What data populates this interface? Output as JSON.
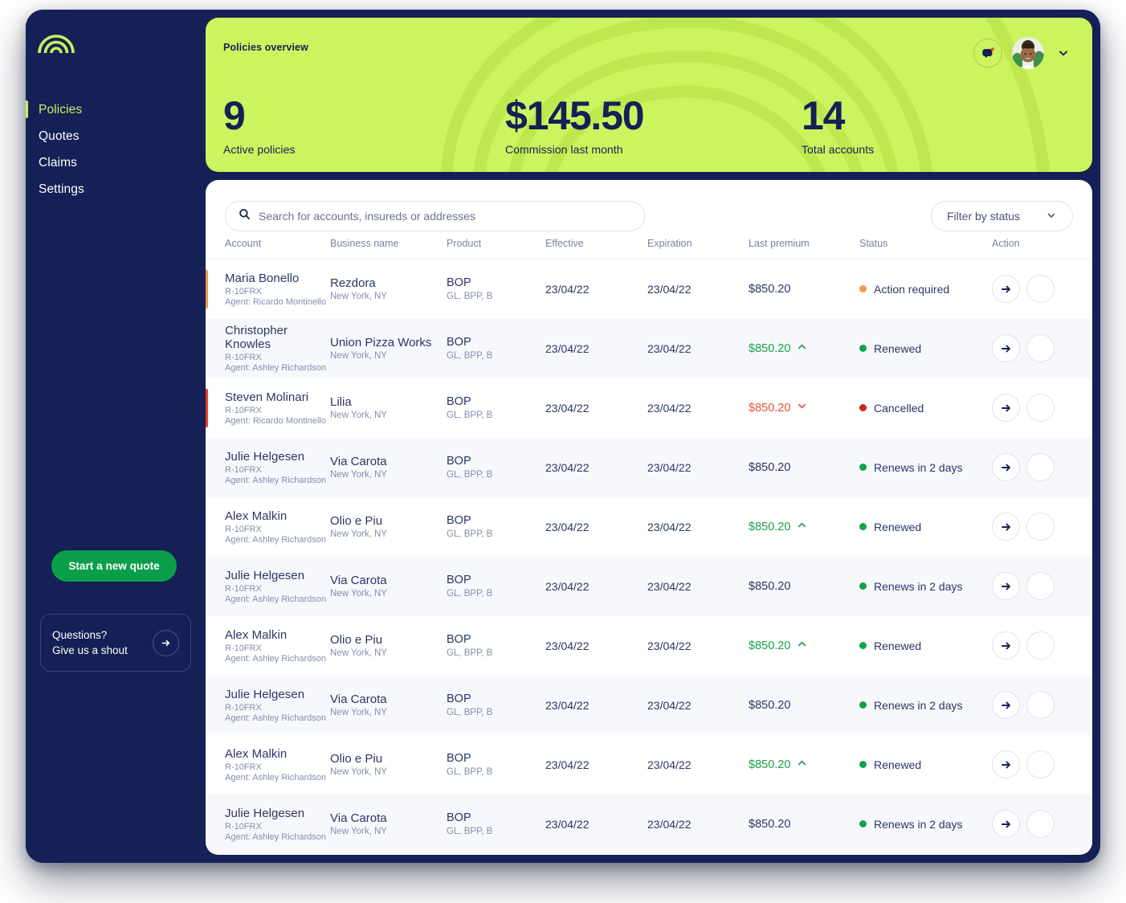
{
  "brand": {
    "logo_icon": "rainbow-arch-logo",
    "navy": "#152056",
    "lime": "#ccf45e",
    "green": "#0b9e4a"
  },
  "sidebar": {
    "items": [
      {
        "label": "Policies",
        "active": true
      },
      {
        "label": "Quotes",
        "active": false
      },
      {
        "label": "Claims",
        "active": false
      },
      {
        "label": "Settings",
        "active": false
      }
    ],
    "cta_quote_label": "Start a new quote",
    "help_line1": "Questions?",
    "help_line2": "Give us a shout",
    "help_arrow_icon": "arrow-right-icon"
  },
  "header": {
    "title": "Policies overview",
    "notification_icon": "chat-bubble-icon",
    "notification_badge_color": "#e8523a",
    "avatar_icon": "user-avatar",
    "chevron_icon": "chevron-down-icon",
    "stats": [
      {
        "value": "9",
        "label": "Active policies"
      },
      {
        "value": "$145.50",
        "label": "Commission last month"
      },
      {
        "value": "14",
        "label": "Total accounts"
      }
    ]
  },
  "toolbar": {
    "search_icon": "search-icon",
    "search_value": "",
    "search_placeholder": "Search for accounts, insureds or addresses",
    "filter_label": "Filter by status",
    "filter_chevron_icon": "chevron-down-icon"
  },
  "table": {
    "columns": [
      "Account",
      "Business name",
      "Product",
      "Effective",
      "Expiration",
      "Last premium",
      "Status",
      "Action"
    ],
    "row_action_icons": [
      "arrow-right-icon",
      "more-vertical-icon"
    ],
    "rows": [
      {
        "account_name": "Maria Bonello",
        "account_id": "R-10FRX",
        "agent": "Agent: Ricardo Montinello",
        "accent_color": "#f6954b",
        "business_name": "Rezdora",
        "business_location": "New York, NY",
        "product": "BOP",
        "product_sub": "GL, BPP, B",
        "effective": "23/04/22",
        "expiration": "23/04/22",
        "premium": "$850.20",
        "premium_trend": "flat",
        "status": "Action required",
        "status_color": "#f6954b"
      },
      {
        "account_name": "Christopher Knowles",
        "account_id": "R-10FRX",
        "agent": "Agent: Ashley Richardson",
        "accent_color": "",
        "business_name": "Union Pizza Works",
        "business_location": "New York, NY",
        "product": "BOP",
        "product_sub": "GL, BPP, B",
        "effective": "23/04/22",
        "expiration": "23/04/22",
        "premium": "$850.20",
        "premium_trend": "up",
        "status": "Renewed",
        "status_color": "#0ea54a"
      },
      {
        "account_name": "Steven Molinari",
        "account_id": "R-10FRX",
        "agent": "Agent: Ricardo Montinello",
        "accent_color": "#e8402a",
        "business_name": "Lilia",
        "business_location": "New York, NY",
        "product": "BOP",
        "product_sub": "GL, BPP, B",
        "effective": "23/04/22",
        "expiration": "23/04/22",
        "premium": "$850.20",
        "premium_trend": "down",
        "status": "Cancelled",
        "status_color": "#cc2a18"
      },
      {
        "account_name": "Julie Helgesen",
        "account_id": "R-10FRX",
        "agent": "Agent: Ashley Richardson",
        "accent_color": "",
        "business_name": "Via Carota",
        "business_location": "New York, NY",
        "product": "BOP",
        "product_sub": "GL, BPP, B",
        "effective": "23/04/22",
        "expiration": "23/04/22",
        "premium": "$850.20",
        "premium_trend": "flat",
        "status": "Renews in 2 days",
        "status_color": "#0ea54a"
      },
      {
        "account_name": "Alex Malkin",
        "account_id": "R-10FRX",
        "agent": "Agent: Ashley Richardson",
        "accent_color": "",
        "business_name": "Olio e Piu",
        "business_location": "New York, NY",
        "product": "BOP",
        "product_sub": "GL, BPP, B",
        "effective": "23/04/22",
        "expiration": "23/04/22",
        "premium": "$850.20",
        "premium_trend": "up",
        "status": "Renewed",
        "status_color": "#0ea54a"
      },
      {
        "account_name": "Julie Helgesen",
        "account_id": "R-10FRX",
        "agent": "Agent: Ashley Richardson",
        "accent_color": "",
        "business_name": "Via Carota",
        "business_location": "New York, NY",
        "product": "BOP",
        "product_sub": "GL, BPP, B",
        "effective": "23/04/22",
        "expiration": "23/04/22",
        "premium": "$850.20",
        "premium_trend": "flat",
        "status": "Renews in 2 days",
        "status_color": "#0ea54a"
      },
      {
        "account_name": "Alex Malkin",
        "account_id": "R-10FRX",
        "agent": "Agent: Ashley Richardson",
        "accent_color": "",
        "business_name": "Olio e Piu",
        "business_location": "New York, NY",
        "product": "BOP",
        "product_sub": "GL, BPP, B",
        "effective": "23/04/22",
        "expiration": "23/04/22",
        "premium": "$850.20",
        "premium_trend": "up",
        "status": "Renewed",
        "status_color": "#0ea54a"
      },
      {
        "account_name": "Julie Helgesen",
        "account_id": "R-10FRX",
        "agent": "Agent: Ashley Richardson",
        "accent_color": "",
        "business_name": "Via Carota",
        "business_location": "New York, NY",
        "product": "BOP",
        "product_sub": "GL, BPP, B",
        "effective": "23/04/22",
        "expiration": "23/04/22",
        "premium": "$850.20",
        "premium_trend": "flat",
        "status": "Renews in 2 days",
        "status_color": "#0ea54a"
      },
      {
        "account_name": "Alex Malkin",
        "account_id": "R-10FRX",
        "agent": "Agent: Ashley Richardson",
        "accent_color": "",
        "business_name": "Olio e Piu",
        "business_location": "New York, NY",
        "product": "BOP",
        "product_sub": "GL, BPP, B",
        "effective": "23/04/22",
        "expiration": "23/04/22",
        "premium": "$850.20",
        "premium_trend": "up",
        "status": "Renewed",
        "status_color": "#0ea54a"
      },
      {
        "account_name": "Julie Helgesen",
        "account_id": "R-10FRX",
        "agent": "Agent: Ashley Richardson",
        "accent_color": "",
        "business_name": "Via Carota",
        "business_location": "New York, NY",
        "product": "BOP",
        "product_sub": "GL, BPP, B",
        "effective": "23/04/22",
        "expiration": "23/04/22",
        "premium": "$850.20",
        "premium_trend": "flat",
        "status": "Renews in 2 days",
        "status_color": "#0ea54a"
      }
    ]
  }
}
